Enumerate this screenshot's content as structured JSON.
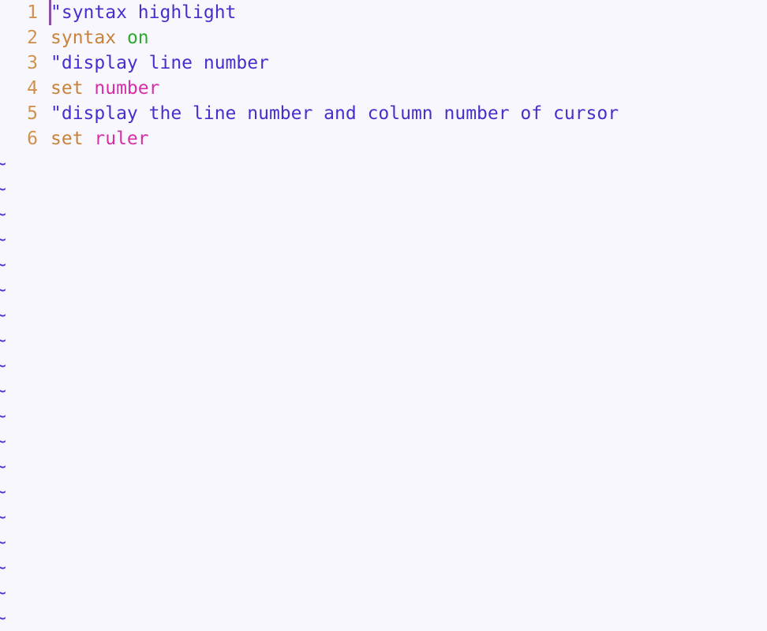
{
  "editor": {
    "name": "vim",
    "background_color": "#f8f7fd",
    "line_height_px": 32,
    "font_size_px": 23,
    "cursor": {
      "shape": "vertical-bar",
      "color": "#8b4fa8",
      "line": 1,
      "column": 1
    },
    "colors": {
      "line_number": "#d0914f",
      "comment": "#4530cc",
      "keyword": "#c8823c",
      "boolean_on": "#2fa82f",
      "option_name": "#d42fa8",
      "tilde": "#4530cc"
    },
    "lines": [
      {
        "number": "1",
        "tokens": [
          {
            "text": "\"syntax highlight",
            "type": "comment"
          }
        ]
      },
      {
        "number": "2",
        "tokens": [
          {
            "text": "syntax ",
            "type": "keyword"
          },
          {
            "text": "on",
            "type": "boolean_on"
          }
        ]
      },
      {
        "number": "3",
        "tokens": [
          {
            "text": "\"display line number",
            "type": "comment"
          }
        ]
      },
      {
        "number": "4",
        "tokens": [
          {
            "text": "set ",
            "type": "keyword"
          },
          {
            "text": "number",
            "type": "option_name"
          }
        ]
      },
      {
        "number": "5",
        "tokens": [
          {
            "text": "\"display the line number and column number of cursor",
            "type": "comment"
          }
        ]
      },
      {
        "number": "6",
        "tokens": [
          {
            "text": "set ",
            "type": "keyword"
          },
          {
            "text": "ruler",
            "type": "option_name"
          }
        ]
      }
    ],
    "tilde_glyph": "~",
    "tilde_count": 19
  }
}
